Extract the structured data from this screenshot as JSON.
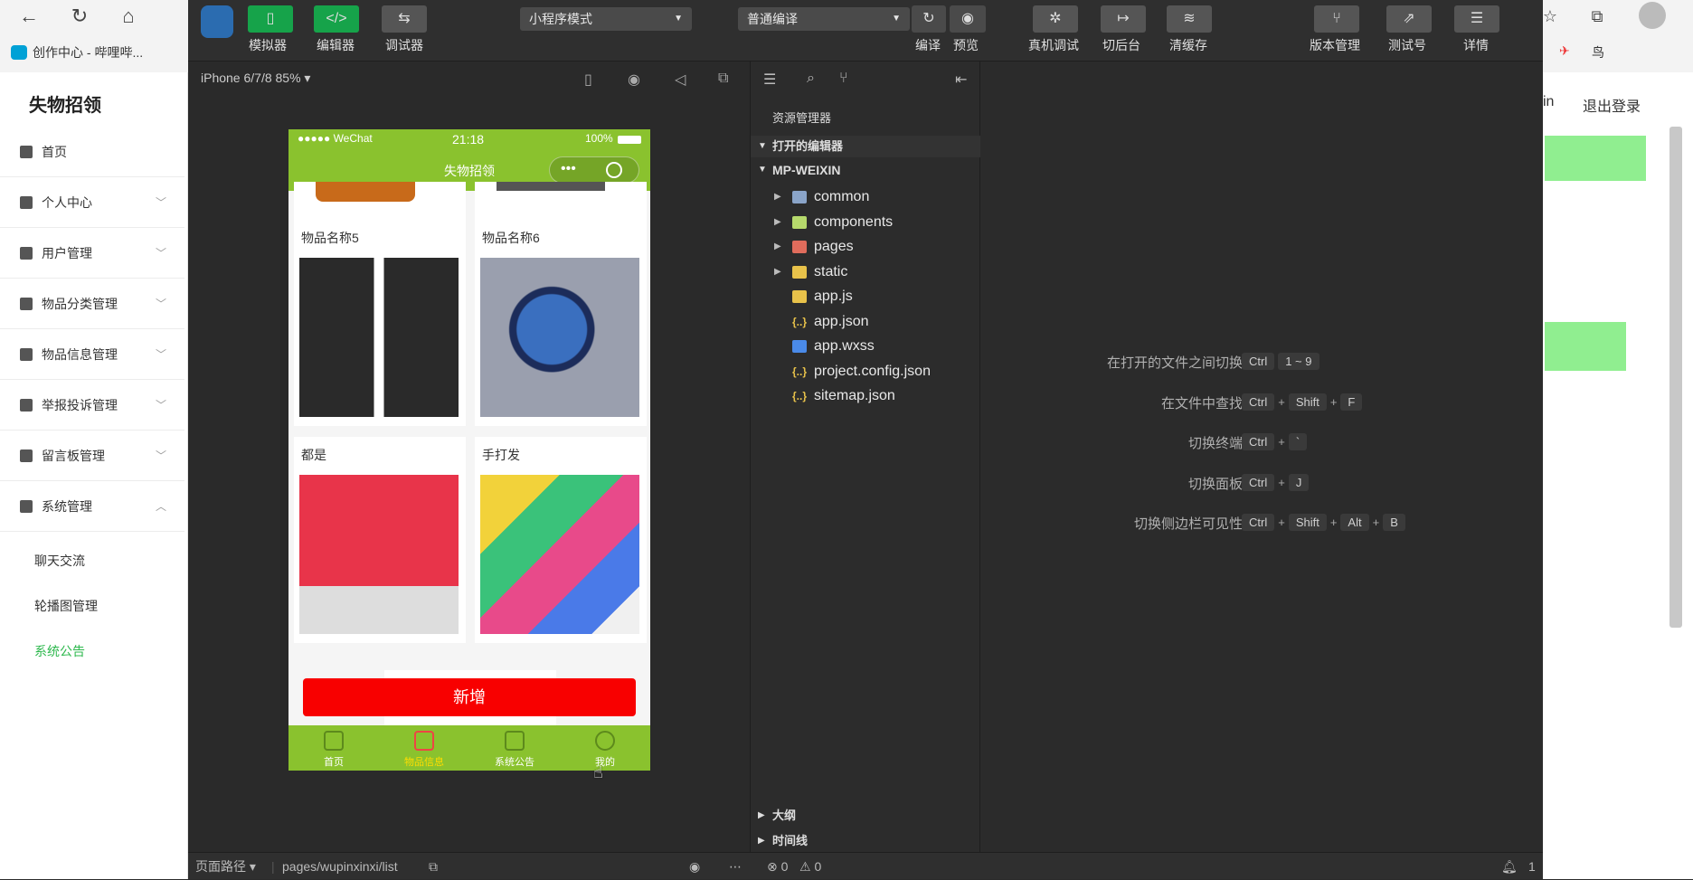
{
  "browser": {
    "bookmark": "创作中心 - 哔哩哔...",
    "right_texts": [
      "in",
      "退出登录"
    ]
  },
  "admin": {
    "brand": "失物招领",
    "menu": [
      {
        "label": "首页",
        "has_chevron": false
      },
      {
        "label": "个人中心",
        "has_chevron": true
      },
      {
        "label": "用户管理",
        "has_chevron": true
      },
      {
        "label": "物品分类管理",
        "has_chevron": true
      },
      {
        "label": "物品信息管理",
        "has_chevron": true
      },
      {
        "label": "举报投诉管理",
        "has_chevron": true
      },
      {
        "label": "留言板管理",
        "has_chevron": true
      },
      {
        "label": "系统管理",
        "has_chevron": true
      }
    ],
    "submenu": [
      "聊天交流",
      "轮播图管理",
      "系统公告"
    ],
    "active_sub": "系统公告"
  },
  "toolbar": {
    "left_buttons": [
      "模拟器",
      "编辑器",
      "调试器"
    ],
    "mode_select": "小程序模式",
    "compile_select": "普通编译",
    "actions": [
      "编译",
      "预览",
      "真机调试",
      "切后台",
      "清缓存"
    ],
    "right_buttons": [
      "版本管理",
      "测试号",
      "详情"
    ]
  },
  "simulator": {
    "device": "iPhone 6/7/8 85%",
    "status_carrier": "●●●●● WeChat",
    "status_time": "21:18",
    "status_battery": "100%",
    "page_title": "失物招领",
    "cards": [
      "物品名称5",
      "物品名称6",
      "都是",
      "手打发"
    ],
    "add_button": "新增",
    "tabs": [
      "首页",
      "物品信息",
      "系统公告",
      "我的"
    ]
  },
  "explorer": {
    "title": "资源管理器",
    "open_editors": "打开的编辑器",
    "project": "MP-WEIXIN",
    "folders": [
      "common",
      "components",
      "pages",
      "static"
    ],
    "files": [
      "app.js",
      "app.json",
      "app.wxss",
      "project.config.json",
      "sitemap.json"
    ],
    "outline": "大纲",
    "timeline": "时间线"
  },
  "editor": {
    "hints": [
      {
        "label": "在打开的文件之间切换",
        "keys": [
          "Ctrl",
          "1 ~ 9"
        ],
        "joined": false
      },
      {
        "label": "在文件中查找",
        "keys": [
          "Ctrl",
          "Shift",
          "F"
        ],
        "joined": true
      },
      {
        "label": "切换终端",
        "keys": [
          "Ctrl",
          "`"
        ],
        "joined": true
      },
      {
        "label": "切换面板",
        "keys": [
          "Ctrl",
          "J"
        ],
        "joined": true
      },
      {
        "label": "切换侧边栏可见性",
        "keys": [
          "Ctrl",
          "Shift",
          "Alt",
          "B"
        ],
        "joined": true
      }
    ]
  },
  "statusbar": {
    "page_path_label": "页面路径",
    "page_path": "pages/wupinxinxi/list",
    "errors": "0",
    "warnings": "0",
    "notifications": "1"
  },
  "colors": {
    "accent_green": "#8ac22e",
    "add_red": "#f80000",
    "active_sub": "#2db84d"
  }
}
